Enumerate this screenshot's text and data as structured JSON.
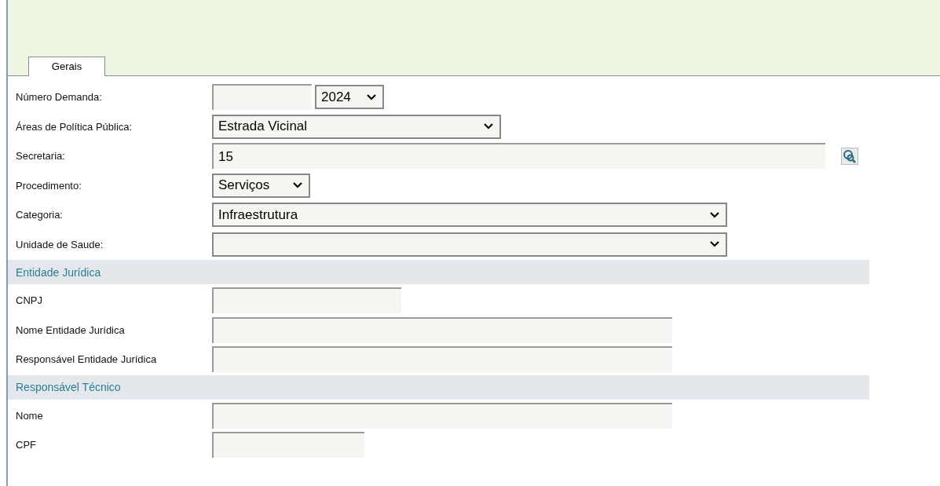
{
  "tabs": [
    {
      "label": "Gerais",
      "selected": true
    }
  ],
  "sections": [
    {
      "rows": [
        {
          "label": "Número Demanda:",
          "controls": [
            {
              "kind": "input"
            },
            {
              "kind": "select",
              "value": "2024"
            }
          ]
        },
        {
          "label": "Áreas de Política Pública:",
          "controls": [
            {
              "kind": "select",
              "value": "Estrada Vicinal"
            }
          ]
        },
        {
          "label": "Secretaria:",
          "controls": [
            {
              "kind": "input",
              "value": "15"
            },
            {
              "kind": "lookup"
            }
          ]
        },
        {
          "label": "Procedimento:",
          "controls": [
            {
              "kind": "select",
              "value": "Serviços"
            }
          ]
        },
        {
          "label": "Categoria:",
          "controls": [
            {
              "kind": "select",
              "value": "Infraestrutura"
            }
          ]
        },
        {
          "label": "Unidade de Saude:",
          "controls": [
            {
              "kind": "select"
            }
          ]
        }
      ]
    },
    {
      "title": "Entidade Jurídica",
      "rows": [
        {
          "label": "CNPJ",
          "controls": [
            {
              "kind": "input"
            }
          ]
        },
        {
          "label": "Nome Entidade Jurídica",
          "controls": [
            {
              "kind": "input"
            }
          ]
        },
        {
          "label": "Responsável Entidade Jurídica",
          "controls": [
            {
              "kind": "input"
            }
          ]
        }
      ]
    },
    {
      "title": "Responsável Técnico",
      "rows": [
        {
          "label": "Nome",
          "controls": [
            {
              "kind": "input"
            }
          ]
        },
        {
          "label": "CPF",
          "controls": [
            {
              "kind": "input"
            }
          ]
        }
      ]
    }
  ]
}
